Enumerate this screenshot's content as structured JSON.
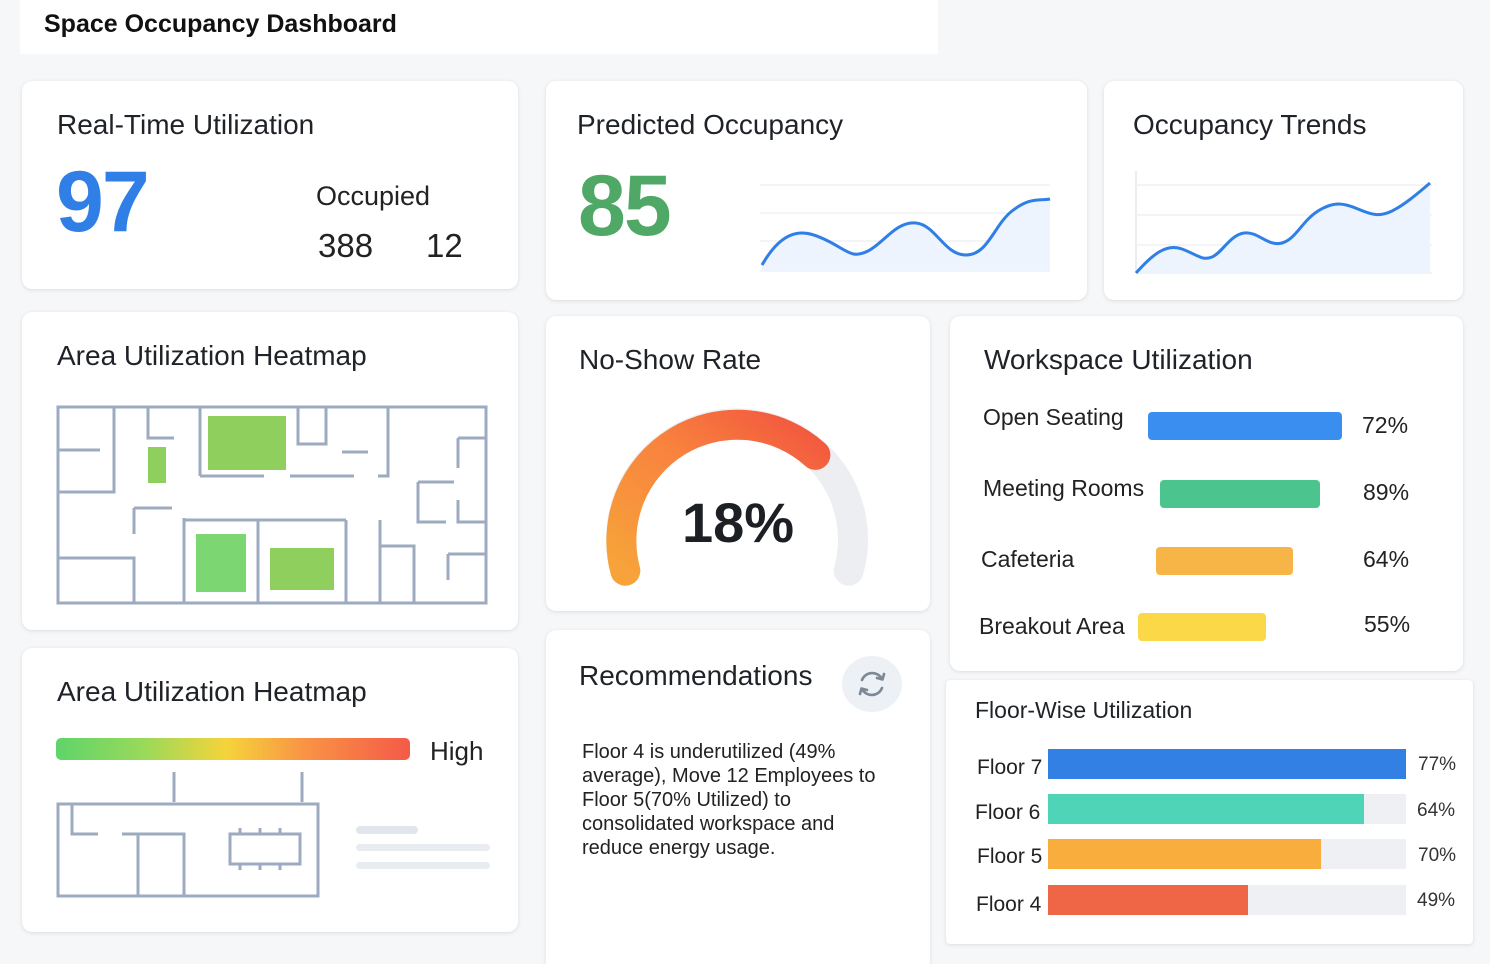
{
  "app": {
    "title": "Space Occupancy Dashboard"
  },
  "realtime": {
    "title": "Real-Time Utilization",
    "value": "97",
    "occupied_label": "Occupied",
    "occupied_value": "388",
    "other_value": "12"
  },
  "predicted": {
    "title": "Predicted Occupancy",
    "value": "85"
  },
  "trends": {
    "title": "Occupancy Trends"
  },
  "heatmap_top": {
    "title": "Area Utilization Heatmap"
  },
  "heatmap_bottom": {
    "title": "Area Utilization Heatmap",
    "legend_high": "High"
  },
  "noshow": {
    "title": "No-Show Rate",
    "value": "18%",
    "rate": 0.18
  },
  "recommendations": {
    "title": "Recommendations",
    "text": "Floor 4 is underutilized (49% average), Move 12 Employees to Floor 5(70% Utilized) to consolidated workspace and reduce energy usage.",
    "refresh_icon": "refresh-icon"
  },
  "workspace": {
    "title": "Workspace Utilization",
    "items": [
      {
        "label": "Open Seating",
        "pct": "72%",
        "value": 72,
        "color": "#3a8ef0"
      },
      {
        "label": "Meeting Rooms",
        "pct": "89%",
        "value": 89,
        "color": "#4cc48d"
      },
      {
        "label": "Cafeteria",
        "pct": "64%",
        "value": 64,
        "color": "#f7b548"
      },
      {
        "label": "Breakout Area",
        "pct": "55%",
        "value": 55,
        "color": "#fbd848"
      }
    ]
  },
  "floors": {
    "title": "Floor-Wise Utilization",
    "items": [
      {
        "label": "Floor 7",
        "pct": "77%",
        "value": 77,
        "color": "#3280e4"
      },
      {
        "label": "Floor 6",
        "pct": "64%",
        "value": 64,
        "color": "#4fd4b8"
      },
      {
        "label": "Floor 5",
        "pct": "70%",
        "value": 70,
        "color": "#f9ad3d"
      },
      {
        "label": "Floor 4",
        "pct": "49%",
        "value": 49,
        "color": "#ef6647"
      }
    ]
  }
}
